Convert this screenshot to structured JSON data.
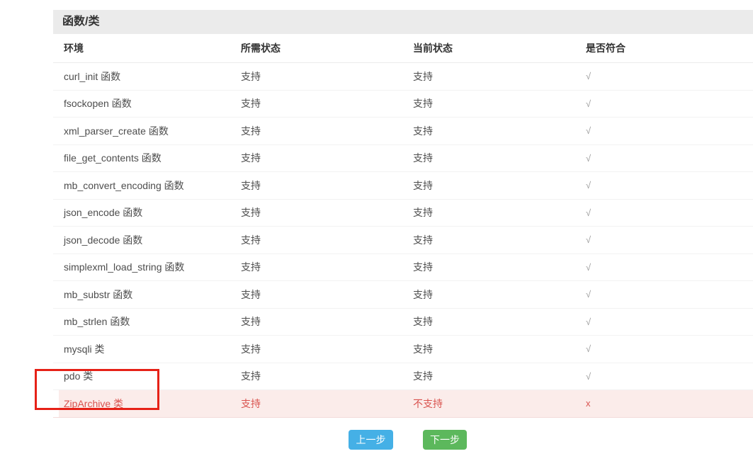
{
  "section": {
    "title": "函数/类"
  },
  "table": {
    "headers": [
      "环境",
      "所需状态",
      "当前状态",
      "是否符合"
    ],
    "rows": [
      {
        "name": "curl_init 函数",
        "required": "支持",
        "current": "支持",
        "ok": "√",
        "status": "pass"
      },
      {
        "name": "fsockopen 函数",
        "required": "支持",
        "current": "支持",
        "ok": "√",
        "status": "pass"
      },
      {
        "name": "xml_parser_create 函数",
        "required": "支持",
        "current": "支持",
        "ok": "√",
        "status": "pass"
      },
      {
        "name": "file_get_contents 函数",
        "required": "支持",
        "current": "支持",
        "ok": "√",
        "status": "pass"
      },
      {
        "name": "mb_convert_encoding 函数",
        "required": "支持",
        "current": "支持",
        "ok": "√",
        "status": "pass"
      },
      {
        "name": "json_encode 函数",
        "required": "支持",
        "current": "支持",
        "ok": "√",
        "status": "pass"
      },
      {
        "name": "json_decode 函数",
        "required": "支持",
        "current": "支持",
        "ok": "√",
        "status": "pass"
      },
      {
        "name": "simplexml_load_string 函数",
        "required": "支持",
        "current": "支持",
        "ok": "√",
        "status": "pass"
      },
      {
        "name": "mb_substr 函数",
        "required": "支持",
        "current": "支持",
        "ok": "√",
        "status": "pass"
      },
      {
        "name": "mb_strlen 函数",
        "required": "支持",
        "current": "支持",
        "ok": "√",
        "status": "pass"
      },
      {
        "name": "mysqli 类",
        "required": "支持",
        "current": "支持",
        "ok": "√",
        "status": "pass"
      },
      {
        "name": "pdo 类",
        "required": "支持",
        "current": "支持",
        "ok": "√",
        "status": "pass"
      },
      {
        "name": "ZipArchive 类",
        "required": "支持",
        "current": "不支持",
        "ok": "x",
        "status": "fail"
      }
    ]
  },
  "buttons": {
    "prev": "上一步",
    "next": "下一步"
  },
  "colors": {
    "prev_button": "#45b0e6",
    "next_button": "#5cb85c",
    "fail_text": "#d9534f",
    "fail_row_bg": "#fbecea",
    "annotation": "#e62117",
    "title_bar_bg": "#ebebeb",
    "pass_mark": "#9a9a9a"
  }
}
